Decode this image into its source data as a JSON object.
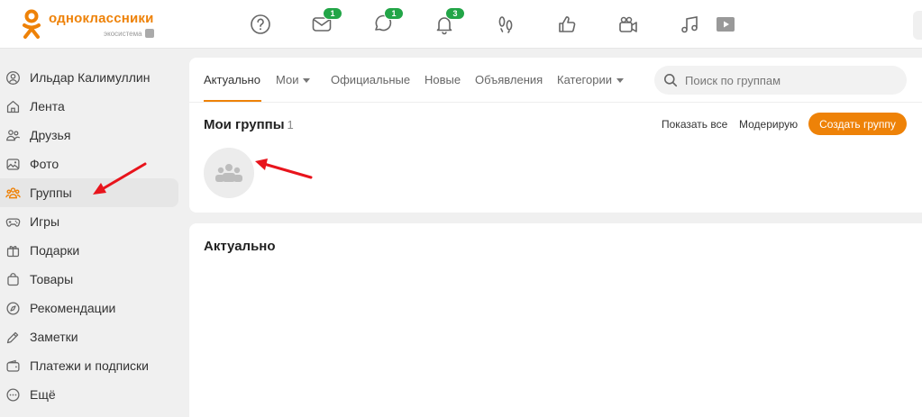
{
  "header": {
    "logo_name": "одноклассники",
    "logo_sub": "экосистема",
    "badges": {
      "messages": "1",
      "discussions": "1",
      "notifications": "3"
    },
    "icons": [
      "help-icon",
      "mail-icon",
      "discussions-icon",
      "bell-icon",
      "footprints-icon",
      "like-icon",
      "video-camera-icon",
      "music-icon",
      "play-icon"
    ]
  },
  "sidebar": {
    "items": [
      {
        "label": "Ильдар Калимуллин",
        "icon": "user-icon"
      },
      {
        "label": "Лента",
        "icon": "home-icon"
      },
      {
        "label": "Друзья",
        "icon": "friends-icon"
      },
      {
        "label": "Фото",
        "icon": "photo-icon"
      },
      {
        "label": "Группы",
        "icon": "groups-icon"
      },
      {
        "label": "Игры",
        "icon": "gamepad-icon"
      },
      {
        "label": "Подарки",
        "icon": "gift-icon"
      },
      {
        "label": "Товары",
        "icon": "bag-icon"
      },
      {
        "label": "Рекомендации",
        "icon": "compass-icon"
      },
      {
        "label": "Заметки",
        "icon": "pencil-icon"
      },
      {
        "label": "Платежи и подписки",
        "icon": "wallet-icon"
      },
      {
        "label": "Ещё",
        "icon": "more-icon"
      }
    ]
  },
  "tabs": {
    "items": [
      "Актуально",
      "Мои",
      "Официальные",
      "Новые",
      "Объявления",
      "Категории"
    ],
    "search_placeholder": "Поиск по группам"
  },
  "my_groups": {
    "title": "Мои группы",
    "count": "1",
    "show_all": "Показать все",
    "moderate": "Модерирую",
    "create": "Создать группу"
  },
  "feed": {
    "title": "Актуально"
  },
  "colors": {
    "accent": "#ee8208",
    "badge": "#22a547",
    "annotation": "#e8141c"
  }
}
